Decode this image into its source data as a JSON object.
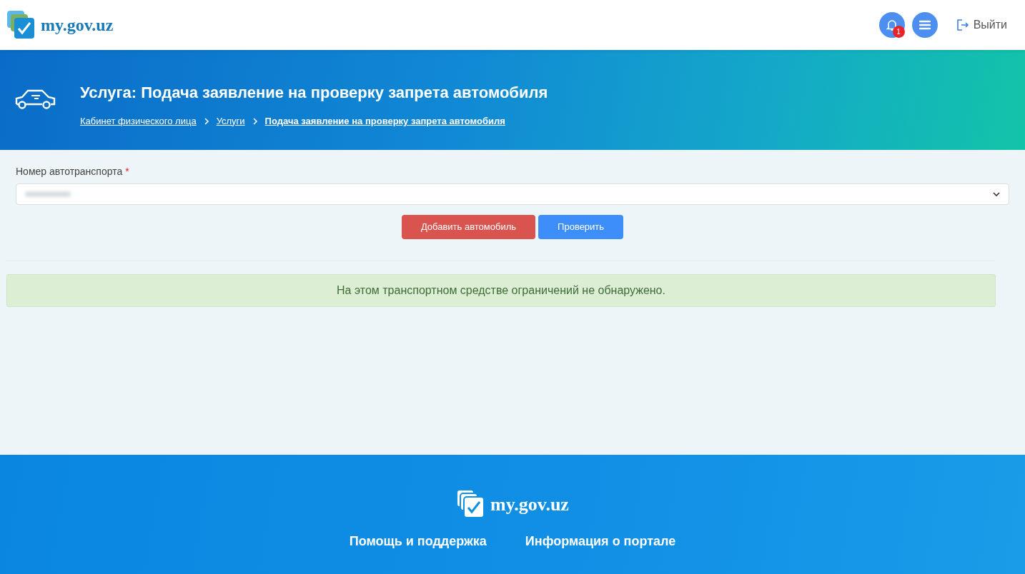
{
  "header": {
    "logo_text": "my.gov.uz",
    "notifications": {
      "count": "1"
    },
    "logout": "Выйти"
  },
  "banner": {
    "title": "Услуга: Подача заявление на проверку запрета автомобиля",
    "breadcrumbs": [
      {
        "label": "Кабинет физического лица",
        "current": false
      },
      {
        "label": "Услуги",
        "current": false
      },
      {
        "label": "Подача заявление на проверку запрета автомобиля",
        "current": true
      }
    ]
  },
  "form": {
    "field_label": "Номер автотранспорта",
    "required_mark": "*",
    "buttons": [
      {
        "label": "Добавить автомобиль",
        "kind": "danger"
      },
      {
        "label": "Проверить",
        "kind": "primary"
      }
    ]
  },
  "alert": {
    "text": "На этом транспортном средстве ограничений не обнаружено."
  },
  "footer": {
    "logo_text": "my.gov.uz",
    "links": [
      "Помощь и поддержка",
      "Информация о портале"
    ]
  }
}
